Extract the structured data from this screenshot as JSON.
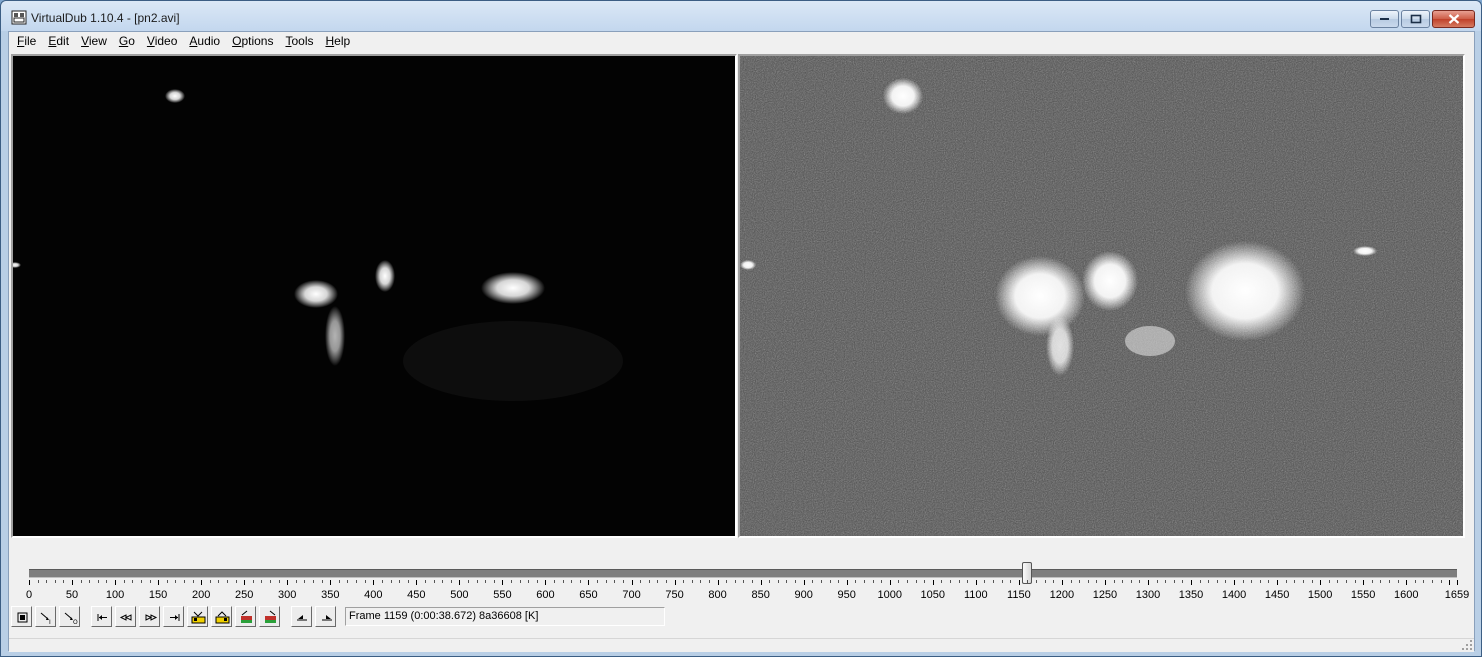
{
  "window": {
    "title": "VirtualDub 1.10.4 - [pn2.avi]",
    "app_icon": "virtualdub-film-icon"
  },
  "menu": [
    {
      "label": "File",
      "access": "F",
      "rest": "ile"
    },
    {
      "label": "Edit",
      "access": "E",
      "rest": "dit"
    },
    {
      "label": "View",
      "access": "V",
      "rest": "iew"
    },
    {
      "label": "Go",
      "access": "G",
      "rest": "o"
    },
    {
      "label": "Video",
      "access": "V",
      "rest": "ideo"
    },
    {
      "label": "Audio",
      "access": "A",
      "rest": "udio"
    },
    {
      "label": "Options",
      "access": "O",
      "rest": "ptions"
    },
    {
      "label": "Tools",
      "access": "T",
      "rest": "ools"
    },
    {
      "label": "Help",
      "access": "H",
      "rest": "elp"
    }
  ],
  "timeline": {
    "min": 0,
    "max": 1659,
    "current_frame": 1159,
    "tick_labels": [
      "0",
      "50",
      "100",
      "150",
      "200",
      "250",
      "300",
      "350",
      "400",
      "450",
      "500",
      "550",
      "600",
      "650",
      "700",
      "750",
      "800",
      "850",
      "900",
      "950",
      "1000",
      "1050",
      "1100",
      "1150",
      "1200",
      "1250",
      "1300",
      "1350",
      "1400",
      "1450",
      "1500",
      "1550",
      "1600",
      "1659"
    ]
  },
  "toolbar": {
    "buttons": [
      {
        "name": "stop-button",
        "icon": "stop-icon"
      },
      {
        "name": "play-input-button",
        "icon": "play-input-icon"
      },
      {
        "name": "play-output-button",
        "icon": "play-output-icon"
      },
      {
        "name": "go-to-start-button",
        "icon": "go-to-start-icon"
      },
      {
        "name": "step-back-button",
        "icon": "step-back-icon"
      },
      {
        "name": "step-forward-button",
        "icon": "step-forward-icon"
      },
      {
        "name": "go-to-end-button",
        "icon": "go-to-end-icon"
      },
      {
        "name": "prev-keyframe-button",
        "icon": "prev-keyframe-icon"
      },
      {
        "name": "next-keyframe-button",
        "icon": "next-keyframe-icon"
      },
      {
        "name": "scene-back-button",
        "icon": "scene-back-icon"
      },
      {
        "name": "scene-forward-button",
        "icon": "scene-forward-icon"
      },
      {
        "name": "mark-in-button",
        "icon": "mark-in-icon"
      },
      {
        "name": "mark-out-button",
        "icon": "mark-out-icon"
      }
    ],
    "frame_status": "Frame 1159 (0:00:38.672) 8a36608 [K]"
  },
  "colors": {
    "input_bg": "#030303",
    "output_bg": "#545454",
    "close_red": "#c0412a"
  }
}
